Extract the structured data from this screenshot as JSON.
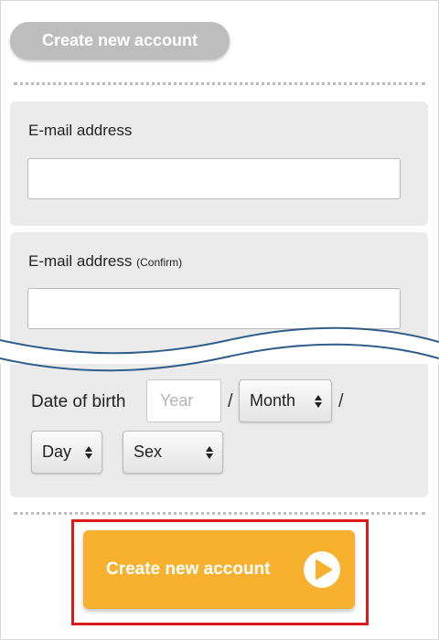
{
  "header": {
    "title": "Create new account"
  },
  "email": {
    "label": "E-mail address",
    "value": ""
  },
  "email_confirm": {
    "label": "E-mail address",
    "label_note": "(Confirm)",
    "value": ""
  },
  "birth": {
    "label": "Date of birth",
    "year_placeholder": "Year",
    "separator": "/",
    "month": "Month",
    "day": "Day"
  },
  "sex": {
    "value": "Sex"
  },
  "cta": {
    "label": "Create new account",
    "icon": "play-icon"
  },
  "colors": {
    "accent": "#f8b12f",
    "highlight": "#dd1a1a",
    "header_pill": "#bdbdbd",
    "panel": "#ebebeb"
  }
}
